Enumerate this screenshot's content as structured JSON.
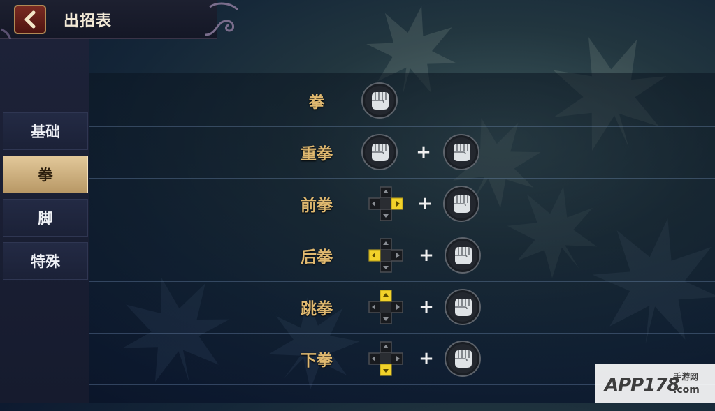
{
  "header": {
    "title": "出招表"
  },
  "sidebar": {
    "items": [
      {
        "label": "基础",
        "active": false
      },
      {
        "label": "拳",
        "active": true
      },
      {
        "label": "脚",
        "active": false
      },
      {
        "label": "特殊",
        "active": false
      }
    ]
  },
  "moves": [
    {
      "name": "拳",
      "inputs": [
        "fist-icon"
      ]
    },
    {
      "name": "重拳",
      "inputs": [
        "fist-icon",
        "plus",
        "fist-icon"
      ]
    },
    {
      "name": "前拳",
      "inputs": [
        "dpad-right-icon",
        "plus",
        "fist-icon"
      ]
    },
    {
      "name": "后拳",
      "inputs": [
        "dpad-left-icon",
        "plus",
        "fist-icon"
      ]
    },
    {
      "name": "跳拳",
      "inputs": [
        "dpad-up-icon",
        "plus",
        "fist-icon"
      ]
    },
    {
      "name": "下拳",
      "inputs": [
        "dpad-down-icon",
        "plus",
        "fist-icon"
      ]
    }
  ],
  "plus_symbol": "+",
  "colors": {
    "move_name": "#e0b970",
    "dpad_highlight": "#f2d22a",
    "sidebar_active": "#d6ba88",
    "back_button": "#6a221c"
  },
  "watermark": {
    "text": "APP178",
    "sub": "手游网",
    "domain": ".com"
  }
}
